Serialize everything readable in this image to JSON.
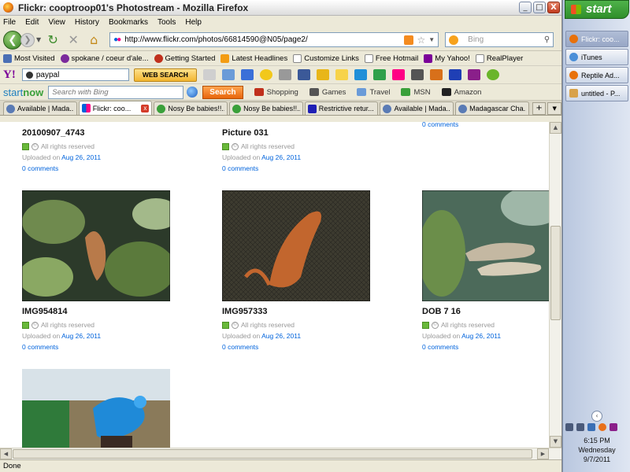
{
  "window": {
    "title": "Flickr: cooptroop01's Photostream - Mozilla Firefox",
    "controls": {
      "minimize": "_",
      "maximize": "□",
      "close": "X"
    }
  },
  "menu": [
    "File",
    "Edit",
    "View",
    "History",
    "Bookmarks",
    "Tools",
    "Help"
  ],
  "nav": {
    "url": "http://www.flickr.com/photos/66814590@N05/page2/",
    "search_placeholder": "Bing"
  },
  "bookmarks": [
    {
      "label": "Most Visited",
      "color": "#4a6fb5"
    },
    {
      "label": "spokane / coeur d'ale...",
      "color": "#7b2a9c"
    },
    {
      "label": "Getting Started",
      "color": "#c0301c"
    },
    {
      "label": "Latest Headlines",
      "color": "#f39c12"
    },
    {
      "label": "Customize Links",
      "color": "#ffffff"
    },
    {
      "label": "Free Hotmail",
      "color": "#ffffff"
    },
    {
      "label": "My Yahoo!",
      "color": "#7b0099"
    },
    {
      "label": "RealPlayer",
      "color": "#ffffff"
    }
  ],
  "yahoo_bar": {
    "logo": "Y!",
    "search_value": "paypal",
    "web_search_label": "WEB SEARCH"
  },
  "startnow_bar": {
    "logo_start": "start",
    "logo_now": "now",
    "search_placeholder": "Search with Bing",
    "search_button": "Search",
    "links": [
      {
        "label": "Shopping",
        "color": "#c0301c"
      },
      {
        "label": "Games",
        "color": "#555555"
      },
      {
        "label": "Travel",
        "color": "#6a9bd8"
      },
      {
        "label": "MSN",
        "color": "#3aa03a"
      },
      {
        "label": "Amazon",
        "color": "#222222"
      }
    ]
  },
  "tabs": [
    {
      "label": "Available | Mada...",
      "active": false,
      "color": "#5a7bb5"
    },
    {
      "label": "Flickr: coo...",
      "active": true,
      "color": "#ff0084"
    },
    {
      "label": "Nosy Be babies!!...",
      "active": false,
      "color": "#3aa03a"
    },
    {
      "label": "Nosy Be babies!!...",
      "active": false,
      "color": "#3aa03a"
    },
    {
      "label": "Restrictive retur...",
      "active": false,
      "color": "#1f1fb5"
    },
    {
      "label": "Available | Mada...",
      "active": false,
      "color": "#5a7bb5"
    },
    {
      "label": "Madagascar Cha...",
      "active": false,
      "color": "#5a7bb5"
    }
  ],
  "photos_top": [
    {
      "title": "20100907_4743",
      "rights": "All rights reserved",
      "uploaded_prefix": "Uploaded on",
      "date": "Aug 26, 2011",
      "comments": "0 comments"
    },
    {
      "title": "Picture 031",
      "rights": "All rights reserved",
      "uploaded_prefix": "Uploaded on",
      "date": "Aug 26, 2011",
      "comments": "0 comments"
    },
    {
      "comments": "0 comments"
    }
  ],
  "photos_mid": [
    {
      "title": "IMG954814",
      "rights": "All rights reserved",
      "uploaded_prefix": "Uploaded on",
      "date": "Aug 26, 2011",
      "comments": "0 comments"
    },
    {
      "title": "IMG957333",
      "rights": "All rights reserved",
      "uploaded_prefix": "Uploaded on",
      "date": "Aug 26, 2011",
      "comments": "0 comments"
    },
    {
      "title": "DOB 7 16",
      "rights": "All rights reserved",
      "uploaded_prefix": "Uploaded on",
      "date": "Aug 26, 2011",
      "comments": "0 comments"
    }
  ],
  "status": "Done",
  "taskbar": {
    "start_label": "start",
    "tasks": [
      {
        "label": "Flickr: coo...",
        "active": true,
        "color": "#e8710a"
      },
      {
        "label": "iTunes",
        "active": false,
        "color": "#4a8fd8"
      },
      {
        "label": "Reptile Ad...",
        "active": false,
        "color": "#e8710a"
      },
      {
        "label": "untitled - P...",
        "active": false,
        "color": "#d8a24a"
      }
    ],
    "clock": {
      "time": "6:15 PM",
      "day": "Wednesday",
      "date": "9/7/2011"
    }
  }
}
